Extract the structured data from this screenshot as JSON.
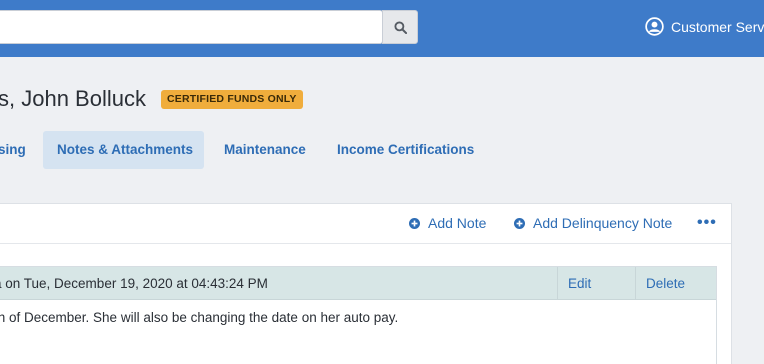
{
  "header": {
    "search": {
      "value": "",
      "placeholder": ""
    },
    "search_icon": "search-icon",
    "user_label": "Customer Serv",
    "user_icon": "user-circle-icon"
  },
  "resident": {
    "name": "s, John Bolluck",
    "badge": "CERTIFIED FUNDS ONLY"
  },
  "tabs": [
    {
      "label": "sing",
      "active": false
    },
    {
      "label": "Notes & Attachments",
      "active": true
    },
    {
      "label": "Maintenance",
      "active": false
    },
    {
      "label": "Income Certifications",
      "active": false
    }
  ],
  "toolbar": {
    "add_note": "Add Note",
    "add_delinquency_note": "Add Delinquency Note",
    "more": "•••"
  },
  "note": {
    "meta": "a on Tue, December 19, 2020 at 04:43:24 PM",
    "edit": "Edit",
    "delete": "Delete",
    "body": "th of December. She will also be changing the date on her auto pay."
  },
  "colors": {
    "topbar": "#3e7bc9",
    "link": "#2e6db5",
    "badge": "#f0ad3c",
    "note_header": "#d7e6e6",
    "active_tab": "#d5e3f1"
  }
}
